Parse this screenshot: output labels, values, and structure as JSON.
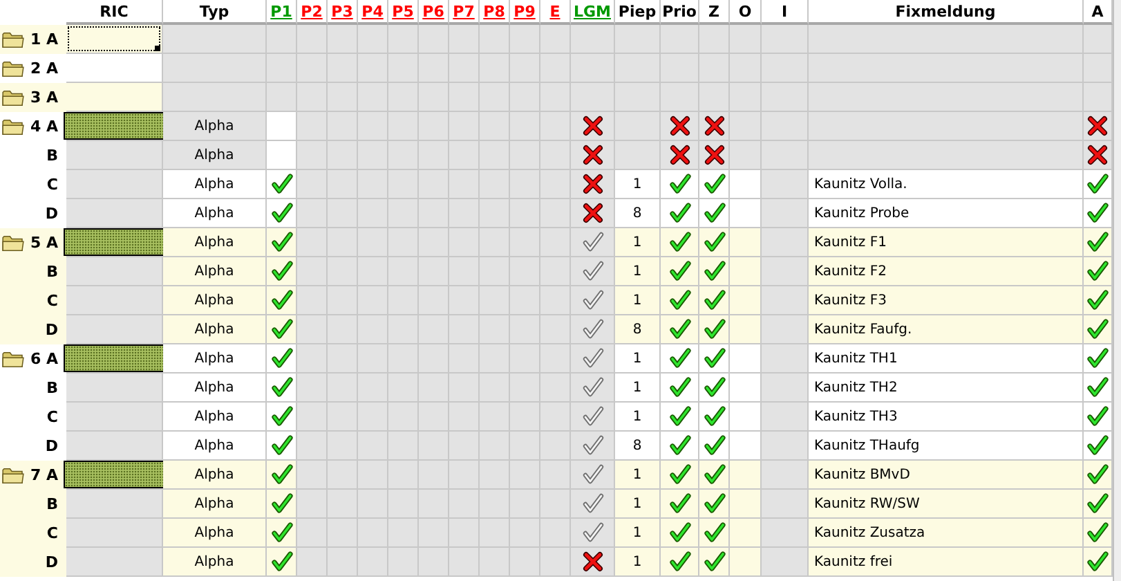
{
  "columns": [
    {
      "label": "RIC",
      "link": false,
      "color": "#000000"
    },
    {
      "label": "Typ",
      "link": false,
      "color": "#000000"
    },
    {
      "label": "P1",
      "link": true,
      "color": "#009900"
    },
    {
      "label": "P2",
      "link": true,
      "color": "#ff0000"
    },
    {
      "label": "P3",
      "link": true,
      "color": "#ff0000"
    },
    {
      "label": "P4",
      "link": true,
      "color": "#ff0000"
    },
    {
      "label": "P5",
      "link": true,
      "color": "#ff0000"
    },
    {
      "label": "P6",
      "link": true,
      "color": "#ff0000"
    },
    {
      "label": "P7",
      "link": true,
      "color": "#ff0000"
    },
    {
      "label": "P8",
      "link": true,
      "color": "#ff0000"
    },
    {
      "label": "P9",
      "link": true,
      "color": "#ff0000"
    },
    {
      "label": "E",
      "link": true,
      "color": "#ff0000"
    },
    {
      "label": "LGM",
      "link": true,
      "color": "#009900"
    },
    {
      "label": "Piep",
      "link": false,
      "color": "#000000"
    },
    {
      "label": "Prio",
      "link": false,
      "color": "#000000"
    },
    {
      "label": "Z",
      "link": false,
      "color": "#000000"
    },
    {
      "label": "O",
      "link": false,
      "color": "#000000"
    },
    {
      "label": "I",
      "link": false,
      "color": "#000000"
    },
    {
      "label": "Fixmeldung",
      "link": false,
      "color": "#000000"
    },
    {
      "label": "A",
      "link": false,
      "color": "#000000"
    }
  ],
  "rows": [
    {
      "label": "1 A",
      "folder": true,
      "kind": "empty",
      "color": "#fdfbe2",
      "selected": true,
      "ric_marked": false
    },
    {
      "label": "2 A",
      "folder": true,
      "kind": "empty",
      "color": "#ffffff",
      "selected": false,
      "ric_marked": false
    },
    {
      "label": "3 A",
      "folder": true,
      "kind": "empty",
      "color": "#fdfbe2",
      "selected": false,
      "ric_marked": false
    },
    {
      "label": "4 A",
      "folder": true,
      "kind": "disabled",
      "color": "#ffffff",
      "selected": false,
      "ric_marked": true,
      "typ": "Alpha",
      "lgm": {
        "kind": "cross"
      },
      "prio": {
        "kind": "cross"
      },
      "z": {
        "kind": "cross"
      },
      "a": {
        "kind": "cross"
      }
    },
    {
      "label": "B",
      "folder": false,
      "kind": "disabled",
      "color": "#ffffff",
      "selected": false,
      "ric_marked": false,
      "typ": "Alpha",
      "lgm": {
        "kind": "cross"
      },
      "prio": {
        "kind": "cross"
      },
      "z": {
        "kind": "cross"
      },
      "a": {
        "kind": "cross"
      }
    },
    {
      "label": "C",
      "folder": false,
      "kind": "active",
      "color": "#ffffff",
      "selected": false,
      "ric_marked": false,
      "typ": "Alpha",
      "p1": {
        "kind": "check"
      },
      "lgm": {
        "kind": "cross"
      },
      "piep": "1",
      "prio": {
        "kind": "check"
      },
      "z": {
        "kind": "check"
      },
      "fix": "Kaunitz Volla.",
      "a": {
        "kind": "check"
      }
    },
    {
      "label": "D",
      "folder": false,
      "kind": "active",
      "color": "#ffffff",
      "selected": false,
      "ric_marked": false,
      "typ": "Alpha",
      "p1": {
        "kind": "check"
      },
      "lgm": {
        "kind": "cross"
      },
      "piep": "8",
      "prio": {
        "kind": "check"
      },
      "z": {
        "kind": "check"
      },
      "fix": "Kaunitz Probe",
      "a": {
        "kind": "check"
      }
    },
    {
      "label": "5 A",
      "folder": true,
      "kind": "active",
      "color": "#fdfbe2",
      "selected": false,
      "ric_marked": true,
      "typ": "Alpha",
      "p1": {
        "kind": "check"
      },
      "lgm": {
        "kind": "grey"
      },
      "piep": "1",
      "prio": {
        "kind": "check"
      },
      "z": {
        "kind": "check"
      },
      "fix": "Kaunitz F1",
      "a": {
        "kind": "check"
      }
    },
    {
      "label": "B",
      "folder": false,
      "kind": "active",
      "color": "#fdfbe2",
      "selected": false,
      "ric_marked": false,
      "typ": "Alpha",
      "p1": {
        "kind": "check"
      },
      "lgm": {
        "kind": "grey"
      },
      "piep": "1",
      "prio": {
        "kind": "check"
      },
      "z": {
        "kind": "check"
      },
      "fix": "Kaunitz F2",
      "a": {
        "kind": "check"
      }
    },
    {
      "label": "C",
      "folder": false,
      "kind": "active",
      "color": "#fdfbe2",
      "selected": false,
      "ric_marked": false,
      "typ": "Alpha",
      "p1": {
        "kind": "check"
      },
      "lgm": {
        "kind": "grey"
      },
      "piep": "1",
      "prio": {
        "kind": "check"
      },
      "z": {
        "kind": "check"
      },
      "fix": "Kaunitz F3",
      "a": {
        "kind": "check"
      }
    },
    {
      "label": "D",
      "folder": false,
      "kind": "active",
      "color": "#fdfbe2",
      "selected": false,
      "ric_marked": false,
      "typ": "Alpha",
      "p1": {
        "kind": "check"
      },
      "lgm": {
        "kind": "grey"
      },
      "piep": "8",
      "prio": {
        "kind": "check"
      },
      "z": {
        "kind": "check"
      },
      "fix": "Kaunitz Faufg.",
      "a": {
        "kind": "check"
      }
    },
    {
      "label": "6 A",
      "folder": true,
      "kind": "active",
      "color": "#ffffff",
      "selected": false,
      "ric_marked": true,
      "typ": "Alpha",
      "p1": {
        "kind": "check"
      },
      "lgm": {
        "kind": "grey"
      },
      "piep": "1",
      "prio": {
        "kind": "check"
      },
      "z": {
        "kind": "check"
      },
      "fix": "Kaunitz TH1",
      "a": {
        "kind": "check"
      }
    },
    {
      "label": "B",
      "folder": false,
      "kind": "active",
      "color": "#ffffff",
      "selected": false,
      "ric_marked": false,
      "typ": "Alpha",
      "p1": {
        "kind": "check"
      },
      "lgm": {
        "kind": "grey"
      },
      "piep": "1",
      "prio": {
        "kind": "check"
      },
      "z": {
        "kind": "check"
      },
      "fix": "Kaunitz TH2",
      "a": {
        "kind": "check"
      }
    },
    {
      "label": "C",
      "folder": false,
      "kind": "active",
      "color": "#ffffff",
      "selected": false,
      "ric_marked": false,
      "typ": "Alpha",
      "p1": {
        "kind": "check"
      },
      "lgm": {
        "kind": "grey"
      },
      "piep": "1",
      "prio": {
        "kind": "check"
      },
      "z": {
        "kind": "check"
      },
      "fix": "Kaunitz TH3",
      "a": {
        "kind": "check"
      }
    },
    {
      "label": "D",
      "folder": false,
      "kind": "active",
      "color": "#ffffff",
      "selected": false,
      "ric_marked": false,
      "typ": "Alpha",
      "p1": {
        "kind": "check"
      },
      "lgm": {
        "kind": "grey"
      },
      "piep": "8",
      "prio": {
        "kind": "check"
      },
      "z": {
        "kind": "check"
      },
      "fix": "Kaunitz THaufg",
      "a": {
        "kind": "check"
      }
    },
    {
      "label": "7 A",
      "folder": true,
      "kind": "active",
      "color": "#fdfbe2",
      "selected": false,
      "ric_marked": true,
      "typ": "Alpha",
      "p1": {
        "kind": "check"
      },
      "lgm": {
        "kind": "grey"
      },
      "piep": "1",
      "prio": {
        "kind": "check"
      },
      "z": {
        "kind": "check"
      },
      "fix": "Kaunitz BMvD",
      "a": {
        "kind": "check"
      }
    },
    {
      "label": "B",
      "folder": false,
      "kind": "active",
      "color": "#fdfbe2",
      "selected": false,
      "ric_marked": false,
      "typ": "Alpha",
      "p1": {
        "kind": "check"
      },
      "lgm": {
        "kind": "grey"
      },
      "piep": "1",
      "prio": {
        "kind": "check"
      },
      "z": {
        "kind": "check"
      },
      "fix": "Kaunitz RW/SW",
      "a": {
        "kind": "check"
      }
    },
    {
      "label": "C",
      "folder": false,
      "kind": "active",
      "color": "#fdfbe2",
      "selected": false,
      "ric_marked": false,
      "typ": "Alpha",
      "p1": {
        "kind": "check"
      },
      "lgm": {
        "kind": "grey"
      },
      "piep": "1",
      "prio": {
        "kind": "check"
      },
      "z": {
        "kind": "check"
      },
      "fix": "Kaunitz Zusatza",
      "a": {
        "kind": "check"
      }
    },
    {
      "label": "D",
      "folder": false,
      "kind": "active",
      "color": "#fdfbe2",
      "selected": false,
      "ric_marked": false,
      "typ": "Alpha",
      "p1": {
        "kind": "check"
      },
      "lgm": {
        "kind": "cross"
      },
      "piep": "1",
      "prio": {
        "kind": "check"
      },
      "z": {
        "kind": "check"
      },
      "fix": "Kaunitz frei",
      "a": {
        "kind": "check"
      }
    }
  ]
}
